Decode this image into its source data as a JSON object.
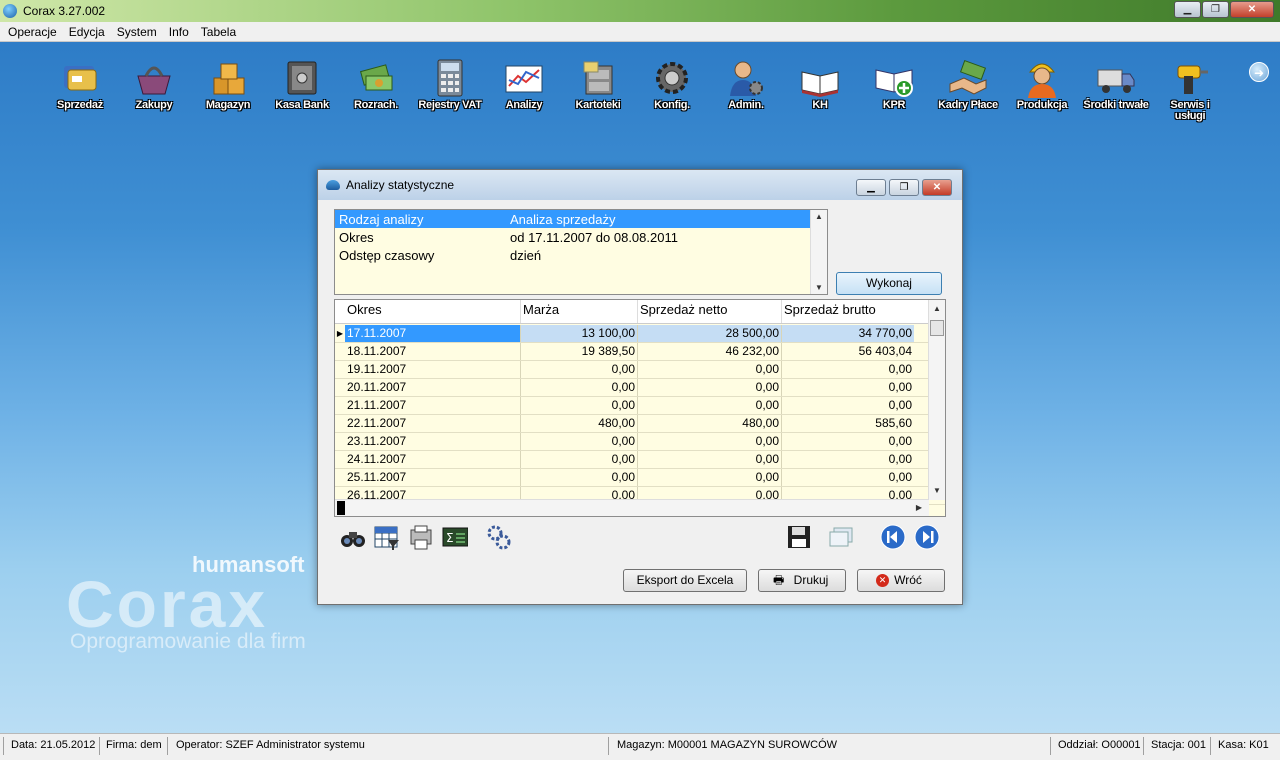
{
  "app": {
    "title": "Corax 3.27.002"
  },
  "menu": [
    "Operacje",
    "Edycja",
    "System",
    "Info",
    "Tabela"
  ],
  "toolbar": [
    {
      "label": "Sprzedaż",
      "icon": "cards-icon"
    },
    {
      "label": "Zakupy",
      "icon": "basket-icon"
    },
    {
      "label": "Magazyn",
      "icon": "boxes-icon"
    },
    {
      "label": "Kasa Bank",
      "icon": "safe-icon"
    },
    {
      "label": "Rozrach.",
      "icon": "money-icon"
    },
    {
      "label": "Rejestry VAT",
      "icon": "calculator-icon"
    },
    {
      "label": "Analizy",
      "icon": "chart-icon"
    },
    {
      "label": "Kartoteki",
      "icon": "cabinet-icon"
    },
    {
      "label": "Konfig.",
      "icon": "gear-icon"
    },
    {
      "label": "Admin.",
      "icon": "user-gear-icon"
    },
    {
      "label": "KH",
      "icon": "book-icon"
    },
    {
      "label": "KPR",
      "icon": "book-plus-icon"
    },
    {
      "label": "Kadry Płace",
      "icon": "handshake-icon"
    },
    {
      "label": "Produkcja",
      "icon": "worker-icon"
    },
    {
      "label": "Środki trwałe",
      "icon": "truck-icon"
    },
    {
      "label": "Serwis i usługi",
      "icon": "drill-icon"
    }
  ],
  "watermark": {
    "brand": "humansoft",
    "logo": "Corax",
    "tagline": "Oprogramowanie dla firm"
  },
  "dialog": {
    "title": "Analizy statystyczne",
    "params": [
      {
        "key": "Rodzaj analizy",
        "value": "Analiza sprzedaży"
      },
      {
        "key": "Okres",
        "value": "od 17.11.2007 do 08.08.2011"
      },
      {
        "key": "Odstęp czasowy",
        "value": "dzień"
      }
    ],
    "execute_label": "Wykonaj",
    "columns": [
      "Okres",
      "Marża",
      "Sprzedaż netto",
      "Sprzedaż brutto"
    ],
    "rows": [
      [
        "17.11.2007",
        "13 100,00",
        "28 500,00",
        "34 770,00"
      ],
      [
        "18.11.2007",
        "19 389,50",
        "46 232,00",
        "56 403,04"
      ],
      [
        "19.11.2007",
        "0,00",
        "0,00",
        "0,00"
      ],
      [
        "20.11.2007",
        "0,00",
        "0,00",
        "0,00"
      ],
      [
        "21.11.2007",
        "0,00",
        "0,00",
        "0,00"
      ],
      [
        "22.11.2007",
        "480,00",
        "480,00",
        "585,60"
      ],
      [
        "23.11.2007",
        "0,00",
        "0,00",
        "0,00"
      ],
      [
        "24.11.2007",
        "0,00",
        "0,00",
        "0,00"
      ],
      [
        "25.11.2007",
        "0,00",
        "0,00",
        "0,00"
      ],
      [
        "26.11.2007",
        "0,00",
        "0,00",
        "0,00"
      ]
    ],
    "buttons": {
      "export": "Eksport do Excela",
      "print": "Drukuj",
      "back": "Wróć"
    }
  },
  "status": {
    "date": "Data: 21.05.2012",
    "firm": "Firma: dem",
    "operator": "Operator: SZEF Administrator systemu",
    "warehouse": "Magazyn: M00001 MAGAZYN SUROWCÓW",
    "branch": "Oddział: O00001",
    "station": "Stacja: 001",
    "register": "Kasa: K01"
  }
}
